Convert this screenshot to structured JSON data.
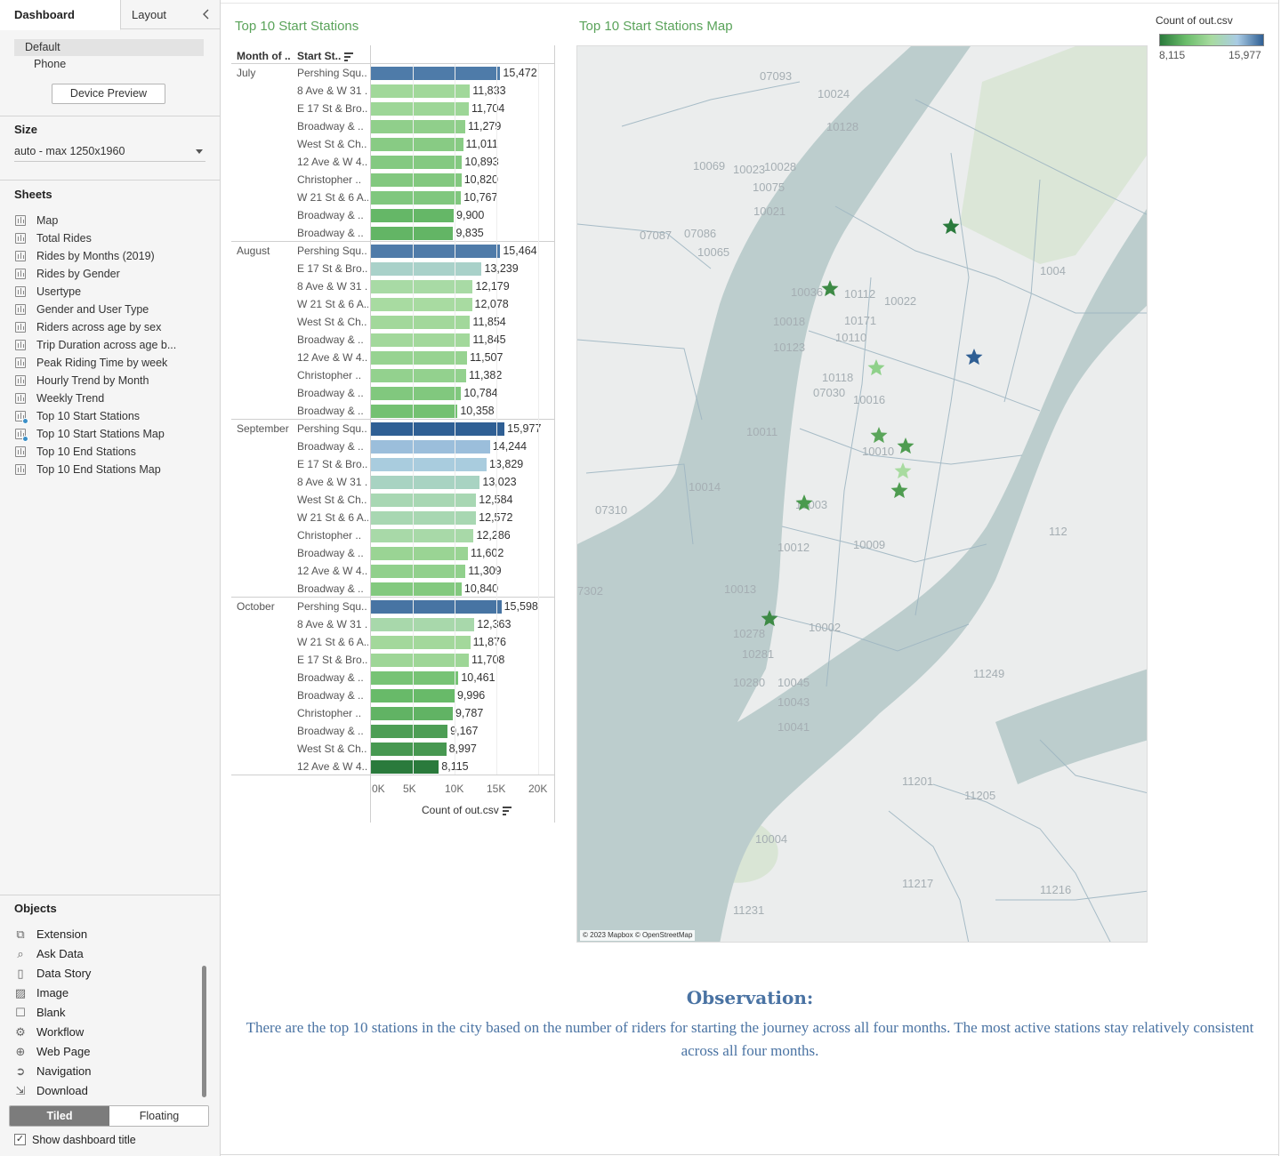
{
  "panel": {
    "tab_dashboard": "Dashboard",
    "tab_layout": "Layout",
    "device_default": "Default",
    "device_phone": "Phone",
    "device_preview_button": "Device Preview",
    "size_title": "Size",
    "size_value": "auto - max 1250x1960",
    "sheets_title": "Sheets",
    "sheets": [
      {
        "label": "Map",
        "in_use": false
      },
      {
        "label": "Total Rides",
        "in_use": false
      },
      {
        "label": "Rides by Months (2019)",
        "in_use": false
      },
      {
        "label": "Rides by Gender",
        "in_use": false
      },
      {
        "label": "Usertype",
        "in_use": false
      },
      {
        "label": "Gender and User Type",
        "in_use": false
      },
      {
        "label": "Riders across age by sex",
        "in_use": false
      },
      {
        "label": "Trip Duration across age b...",
        "in_use": false
      },
      {
        "label": "Peak Riding Time by week",
        "in_use": false
      },
      {
        "label": "Hourly Trend by Month",
        "in_use": false
      },
      {
        "label": "Weekly Trend",
        "in_use": false
      },
      {
        "label": "Top 10 Start Stations",
        "in_use": true
      },
      {
        "label": "Top 10 Start Stations Map",
        "in_use": true
      },
      {
        "label": "Top 10 End Stations",
        "in_use": false
      },
      {
        "label": "Top 10 End Stations Map",
        "in_use": false
      }
    ],
    "objects_title": "Objects",
    "objects": [
      {
        "label": "Extension",
        "icon": "extension-icon"
      },
      {
        "label": "Ask Data",
        "icon": "ask-data-icon"
      },
      {
        "label": "Data Story",
        "icon": "data-story-icon"
      },
      {
        "label": "Image",
        "icon": "image-icon"
      },
      {
        "label": "Blank",
        "icon": "blank-icon"
      },
      {
        "label": "Workflow",
        "icon": "workflow-icon"
      },
      {
        "label": "Web Page",
        "icon": "globe-icon"
      },
      {
        "label": "Navigation",
        "icon": "navigation-icon"
      },
      {
        "label": "Download",
        "icon": "download-icon"
      }
    ],
    "tiled_label": "Tiled",
    "floating_label": "Floating",
    "show_title_label": "Show dashboard title",
    "show_title_checked": true
  },
  "dashboard": {
    "bar_sheet_title": "Top 10 Start Stations",
    "map_sheet_title": "Top 10 Start Stations Map",
    "col_month_header": "Month of ..",
    "col_station_header": "Start St..",
    "map_credit": "© 2023 Mapbox © OpenStreetMap",
    "legend": {
      "title": "Count of out.csv",
      "min_label": "8,115",
      "max_label": "15,977",
      "min": 8115,
      "max": 15977,
      "colors": [
        "#2a7a3c",
        "#6bbd6b",
        "#a8dba0",
        "#a9cbe4",
        "#2f5f94"
      ]
    },
    "map_zip_labels": [
      "07093",
      "10024",
      "10128",
      "10069",
      "10023",
      "10028",
      "10075",
      "10021",
      "07087",
      "07086",
      "10065",
      "10036",
      "10112",
      "10022",
      "10018",
      "10171",
      "10110",
      "10123",
      "10118",
      "10016",
      "07030",
      "10011",
      "10010",
      "10014",
      "10003",
      "07310",
      "10012",
      "10009",
      "10013",
      "10002",
      "10278",
      "10281",
      "10280",
      "10045",
      "10043",
      "10041",
      "11249",
      "11201",
      "11205",
      "10004",
      "11217",
      "11231",
      "11216",
      "7302",
      "112",
      "1004"
    ],
    "observation_title": "Observation:",
    "observation_text": "There are the top 10 stations in the city based on the number of riders for starting the journey across all four months. The most active stations stay relatively consistent across all four months."
  },
  "chart_data": {
    "type": "bar",
    "orientation": "horizontal",
    "xlabel": "Count of out.csv",
    "xlim": [
      0,
      22000
    ],
    "x_ticks": [
      "0K",
      "5K",
      "10K",
      "15K",
      "20K"
    ],
    "groups": [
      {
        "month": "July",
        "rows": [
          {
            "station": "Pershing Squ..",
            "value": 15472,
            "label": "15,472"
          },
          {
            "station": "8 Ave & W 31 ..",
            "value": 11833,
            "label": "11,833"
          },
          {
            "station": "E 17 St & Bro..",
            "value": 11704,
            "label": "11,704"
          },
          {
            "station": "Broadway & ..",
            "value": 11279,
            "label": "11,279"
          },
          {
            "station": "West St & Ch..",
            "value": 11011,
            "label": "11,011"
          },
          {
            "station": "12 Ave & W 4..",
            "value": 10893,
            "label": "10,893"
          },
          {
            "station": "Christopher ..",
            "value": 10820,
            "label": "10,820"
          },
          {
            "station": "W 21 St & 6 A..",
            "value": 10767,
            "label": "10,767"
          },
          {
            "station": "Broadway & ..",
            "value": 9900,
            "label": "9,900"
          },
          {
            "station": "Broadway & ..",
            "value": 9835,
            "label": "9,835"
          }
        ]
      },
      {
        "month": "August",
        "rows": [
          {
            "station": "Pershing Squ..",
            "value": 15464,
            "label": "15,464"
          },
          {
            "station": "E 17 St & Bro..",
            "value": 13239,
            "label": "13,239"
          },
          {
            "station": "8 Ave & W 31 ..",
            "value": 12179,
            "label": "12,179"
          },
          {
            "station": "W 21 St & 6 A..",
            "value": 12078,
            "label": "12,078"
          },
          {
            "station": "West St & Ch..",
            "value": 11854,
            "label": "11,854"
          },
          {
            "station": "Broadway & ..",
            "value": 11845,
            "label": "11,845"
          },
          {
            "station": "12 Ave & W 4..",
            "value": 11507,
            "label": "11,507"
          },
          {
            "station": "Christopher ..",
            "value": 11382,
            "label": "11,382"
          },
          {
            "station": "Broadway & ..",
            "value": 10784,
            "label": "10,784"
          },
          {
            "station": "Broadway & ..",
            "value": 10358,
            "label": "10,358"
          }
        ]
      },
      {
        "month": "September",
        "rows": [
          {
            "station": "Pershing Squ..",
            "value": 15977,
            "label": "15,977"
          },
          {
            "station": "Broadway & ..",
            "value": 14244,
            "label": "14,244"
          },
          {
            "station": "E 17 St & Bro..",
            "value": 13829,
            "label": "13,829"
          },
          {
            "station": "8 Ave & W 31 ..",
            "value": 13023,
            "label": "13,023"
          },
          {
            "station": "West St & Ch..",
            "value": 12584,
            "label": "12,584"
          },
          {
            "station": "W 21 St & 6 A..",
            "value": 12572,
            "label": "12,572"
          },
          {
            "station": "Christopher ..",
            "value": 12286,
            "label": "12,286"
          },
          {
            "station": "Broadway & ..",
            "value": 11602,
            "label": "11,602"
          },
          {
            "station": "12 Ave & W 4..",
            "value": 11309,
            "label": "11,309"
          },
          {
            "station": "Broadway & ..",
            "value": 10840,
            "label": "10,840"
          }
        ]
      },
      {
        "month": "October",
        "rows": [
          {
            "station": "Pershing Squ..",
            "value": 15598,
            "label": "15,598"
          },
          {
            "station": "8 Ave & W 31 ..",
            "value": 12363,
            "label": "12,363"
          },
          {
            "station": "W 21 St & 6 A..",
            "value": 11876,
            "label": "11,876"
          },
          {
            "station": "E 17 St & Bro..",
            "value": 11708,
            "label": "11,708"
          },
          {
            "station": "Broadway & ..",
            "value": 10461,
            "label": "10,461"
          },
          {
            "station": "Broadway & ..",
            "value": 9996,
            "label": "9,996"
          },
          {
            "station": "Christopher ..",
            "value": 9787,
            "label": "9,787"
          },
          {
            "station": "Broadway & ..",
            "value": 9167,
            "label": "9,167"
          },
          {
            "station": "West St & Ch..",
            "value": 8997,
            "label": "8,997"
          },
          {
            "station": "12 Ave & W 4..",
            "value": 8115,
            "label": "8,115"
          }
        ]
      }
    ]
  }
}
